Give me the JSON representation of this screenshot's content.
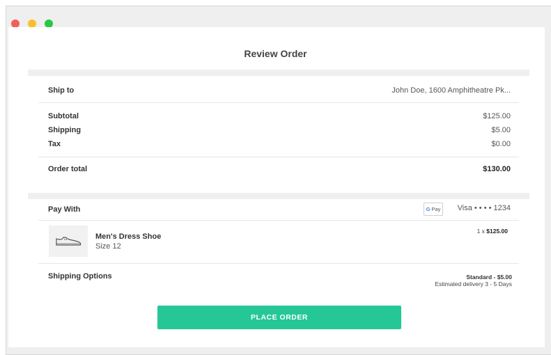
{
  "window": {
    "controls": [
      "close",
      "minimize",
      "maximize"
    ],
    "colors": {
      "close": "#f25f58",
      "minimize": "#fbbe2e",
      "maximize": "#28c840"
    }
  },
  "page": {
    "title": "Review Order"
  },
  "shipping_address": {
    "label": "Ship to",
    "value": "John Doe, 1600 Amphitheatre Pk..."
  },
  "totals": {
    "subtotal": {
      "label": "Subtotal",
      "value": "$125.00"
    },
    "shipping": {
      "label": "Shipping",
      "value": "$5.00"
    },
    "tax": {
      "label": "Tax",
      "value": "$0.00"
    },
    "order_total": {
      "label": "Order total",
      "value": "$130.00"
    }
  },
  "payment": {
    "label": "Pay With",
    "badge_g": "G",
    "badge_text": "Pay",
    "card": "Visa • • • • 1234"
  },
  "item": {
    "icon": "shoe-icon",
    "name": "Men's Dress Shoe",
    "size": "Size 12",
    "qty_prefix": "1 x ",
    "price": "$125.00"
  },
  "shipping_options": {
    "label": "Shipping Options",
    "selected": "Standard - $5.00",
    "estimate": "Estimated delivery 3 - 5 Days"
  },
  "actions": {
    "place_order": "PLACE ORDER",
    "accent": "#26c797"
  }
}
